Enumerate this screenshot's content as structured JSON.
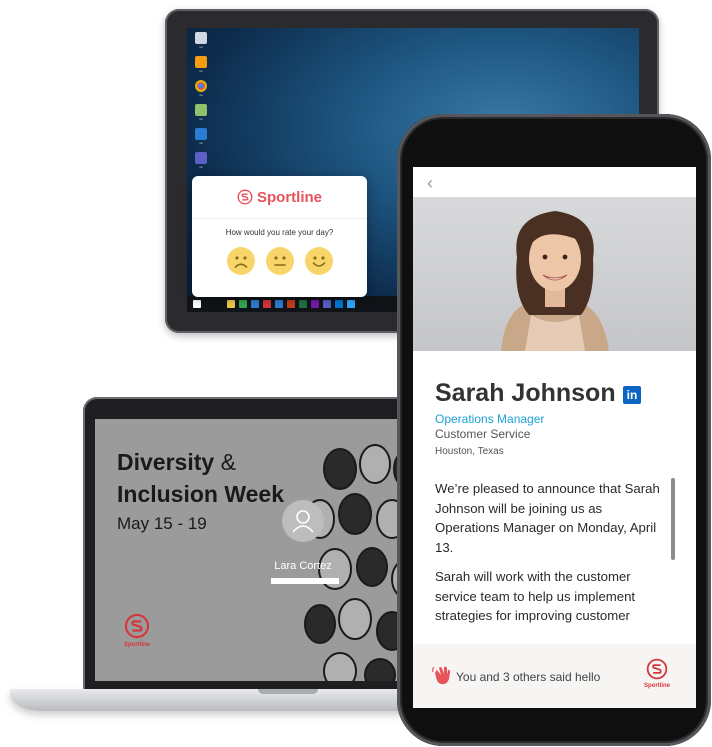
{
  "brand": {
    "name": "Sportline",
    "color": "#e8535a"
  },
  "survey": {
    "question": "How would you rate your day?",
    "options": [
      "sad-face-icon",
      "neutral-face-icon",
      "happy-face-icon"
    ]
  },
  "laptop": {
    "title_bold_1": "Diversity",
    "title_amp": "&",
    "title_bold_2": "Inclusion Week",
    "date": "May 15 - 19",
    "login_name": "Lara Cortez"
  },
  "profile": {
    "name": "Sarah Johnson",
    "linkedin": "in",
    "role": "Operations Manager",
    "department": "Customer Service",
    "location": "Houston, Texas",
    "paragraphs": [
      "We’re pleased to announce that Sarah Johnson will be joining us as Operations Manager on Monday, April 13.",
      "Sarah will work with the customer service team to help us implement strategies for improving customer"
    ],
    "hello_text": "You and 3 others said hello"
  },
  "colors": {
    "linkedin": "#0a66c2",
    "role": "#1da1d6",
    "logo_red": "#d6343b"
  }
}
